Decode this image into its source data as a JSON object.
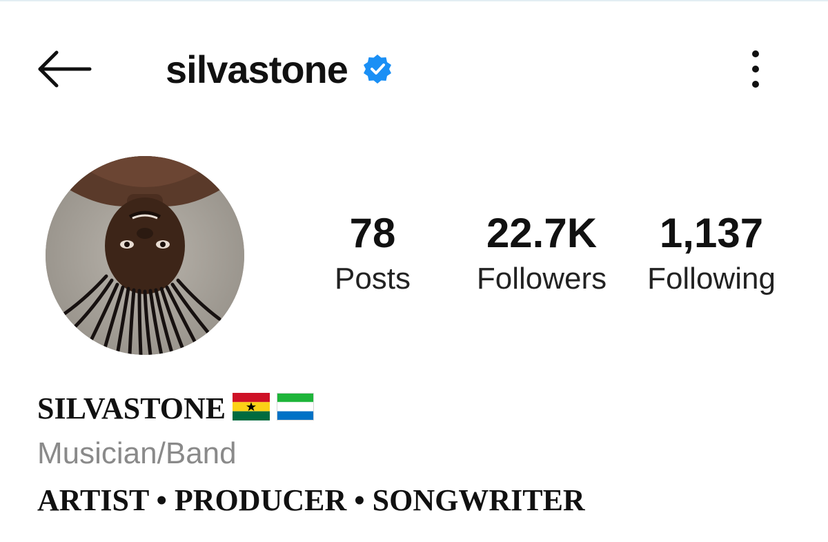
{
  "header": {
    "username": "silvastone",
    "verified": true,
    "back_icon": "arrow-left-icon",
    "more_icon": "more-vertical-icon",
    "accent_color": "#1a8ff5"
  },
  "profile": {
    "avatar_icon": "profile-photo"
  },
  "stats": {
    "posts": {
      "value": "78",
      "label": "Posts"
    },
    "followers": {
      "value": "22.7K",
      "label": "Followers"
    },
    "following": {
      "value": "1,137",
      "label": "Following"
    }
  },
  "bio": {
    "display_name": "SILVASTONE",
    "flags": [
      "ghana-flag-icon",
      "sierra-leone-flag-icon"
    ],
    "category": "Musician/Band",
    "tagline": "ARTIST • PRODUCER • SONGWRITER"
  }
}
